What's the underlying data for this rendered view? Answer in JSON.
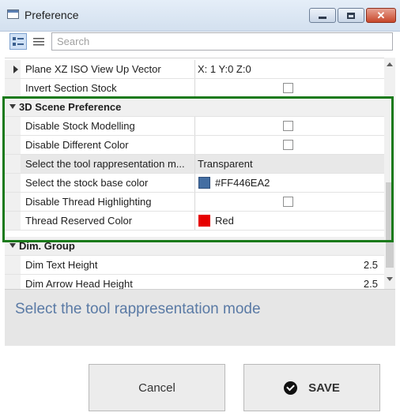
{
  "window": {
    "title": "Preference"
  },
  "toolbar": {
    "search_placeholder": "Search"
  },
  "rows": [
    {
      "name": "Plane XZ ISO View Up Vector",
      "value": "X: 1 Y:0 Z:0"
    },
    {
      "name": "Invert Section Stock",
      "checked": false
    },
    {
      "category": "3D Scene Preference"
    },
    {
      "name": "Disable Stock Modelling",
      "checked": false
    },
    {
      "name": "Disable Different Color",
      "checked": false
    },
    {
      "name": "Select the tool rappresentation m...",
      "value": "Transparent",
      "selected": true
    },
    {
      "name": "Select the stock base color",
      "value": "#FF446EA2",
      "color": "#446EA2"
    },
    {
      "name": "Disable Thread Highlighting",
      "checked": false
    },
    {
      "name": "Thread Reserved Color",
      "value": "Red",
      "color": "#e60000"
    },
    {
      "category": "Dim. Group"
    },
    {
      "name": "Dim Text Height",
      "value": "2.5"
    },
    {
      "name": "Dim Arrow Head Height",
      "value": "2.5"
    }
  ],
  "description": "Select the tool rappresentation mode",
  "buttons": {
    "cancel": "Cancel",
    "save": "SAVE"
  },
  "colors": {
    "highlight": "#1a7a1a",
    "accent": "#5a7aa5"
  }
}
